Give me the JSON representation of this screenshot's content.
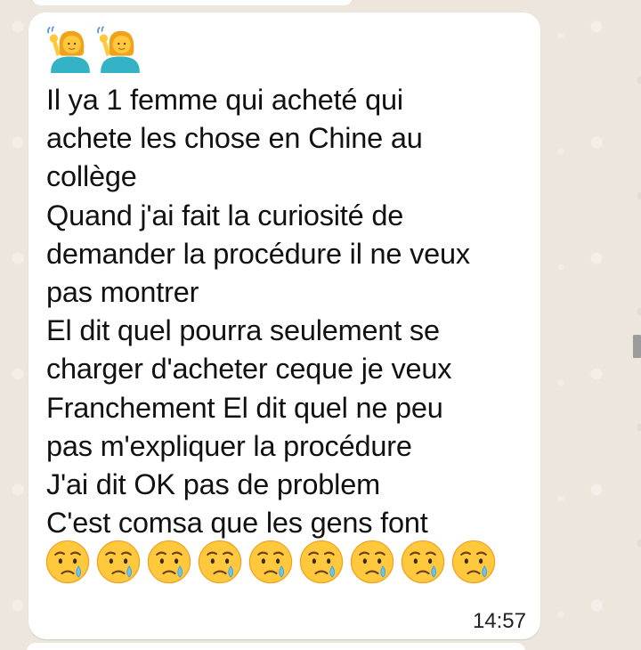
{
  "message": {
    "header_emoji": {
      "icon": "person-raising-hand-icon",
      "count": 2,
      "symbol": "🙋‍♀️🙋‍♀️"
    },
    "lines": [
      "Il ya 1 femme qui acheté qui",
      "achete les chose en Chine au",
      "collège",
      "Quand j'ai fait la curiosité de",
      "demander la procédure il ne veux",
      "pas montrer",
      "El dit quel pourra seulement se",
      "charger d'acheter ceque je veux",
      "Franchement El dit quel ne peu",
      "pas m'expliquer la procédure",
      "J'ai dit OK pas de problem",
      "C'est comsa que les gens font"
    ],
    "trailing_emoji": {
      "icon": "crying-face-icon",
      "count": 9,
      "symbol": "😢😢😢😢😢😢😢😢😢"
    },
    "time": "14:57"
  },
  "colors": {
    "chat_background": "#ece6dc",
    "bubble": "#ffffff",
    "text": "#111111",
    "emoji_face": "#ffc83d",
    "tear": "#6fc2ea"
  }
}
